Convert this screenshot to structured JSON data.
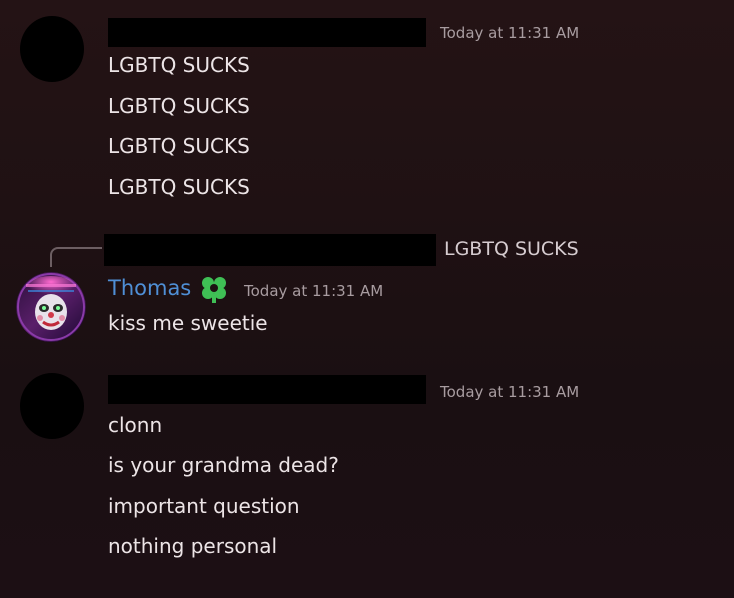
{
  "messages": [
    {
      "timestamp": "Today at 11:31 AM",
      "lines": [
        "LGBTQ SUCKS",
        "LGBTQ SUCKS",
        "LGBTQ SUCKS",
        "LGBTQ SUCKS"
      ]
    },
    {
      "reply_preview": "LGBTQ SUCKS",
      "author": "Thomas",
      "badge_icon": "flower-badge-icon",
      "timestamp": "Today at 11:31 AM",
      "lines": [
        "kiss me sweetie"
      ],
      "author_color": "#4f8fd6",
      "badge_color": "#3fbf55"
    },
    {
      "timestamp": "Today at 11:31 AM",
      "lines": [
        "clonn",
        "is your grandma dead?",
        "important question",
        "nothing personal"
      ]
    }
  ]
}
